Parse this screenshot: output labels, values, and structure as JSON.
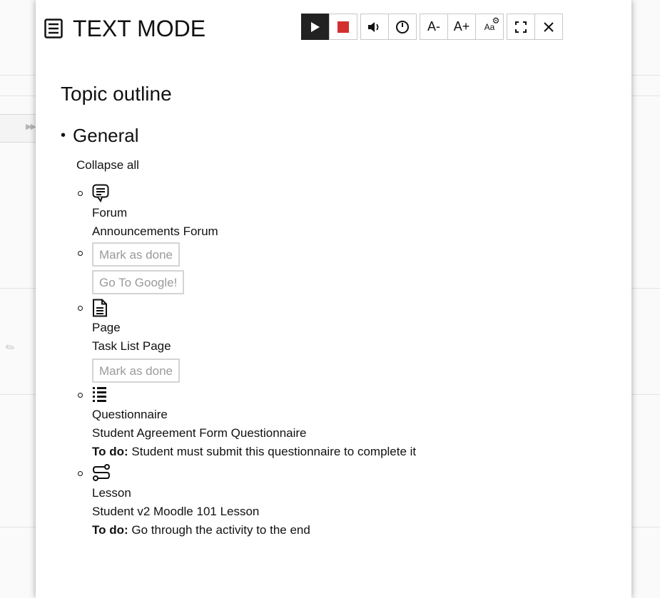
{
  "overlay": {
    "title": "TEXT MODE",
    "toolbar": {
      "play": "▶",
      "stop": "■",
      "volume": "🔊",
      "speed": "ⓘ",
      "font_decrease": "A-",
      "font_increase": "A+",
      "font_settings": "Aa",
      "fullscreen": "⛶",
      "close": "✕"
    }
  },
  "content": {
    "heading": "Topic outline",
    "section_title": "General",
    "collapse_link": "Collapse all",
    "items": [
      {
        "type": "Forum",
        "name": "Announcements Forum",
        "icon": "forum-icon"
      },
      {
        "button": "Mark as done"
      },
      {
        "button": "Go To Google!"
      },
      {
        "type": "Page",
        "name": "Task List Page",
        "icon": "page-icon",
        "button": "Mark as done"
      },
      {
        "type": "Questionnaire",
        "name": "Student Agreement Form Questionnaire",
        "icon": "questionnaire-icon",
        "todo_label": "To do:",
        "todo_text": " Student must submit this questionnaire to complete it"
      },
      {
        "type": "Lesson",
        "name": "Student v2 Moodle 101 Lesson",
        "icon": "lesson-icon",
        "todo_label": "To do:",
        "todo_text": " Go through the activity to the end"
      }
    ]
  },
  "colors": {
    "play_bg": "#222222",
    "stop_red": "#d32f2f",
    "disabled_text": "#9a9a9a",
    "disabled_border": "#d4d4d4"
  }
}
